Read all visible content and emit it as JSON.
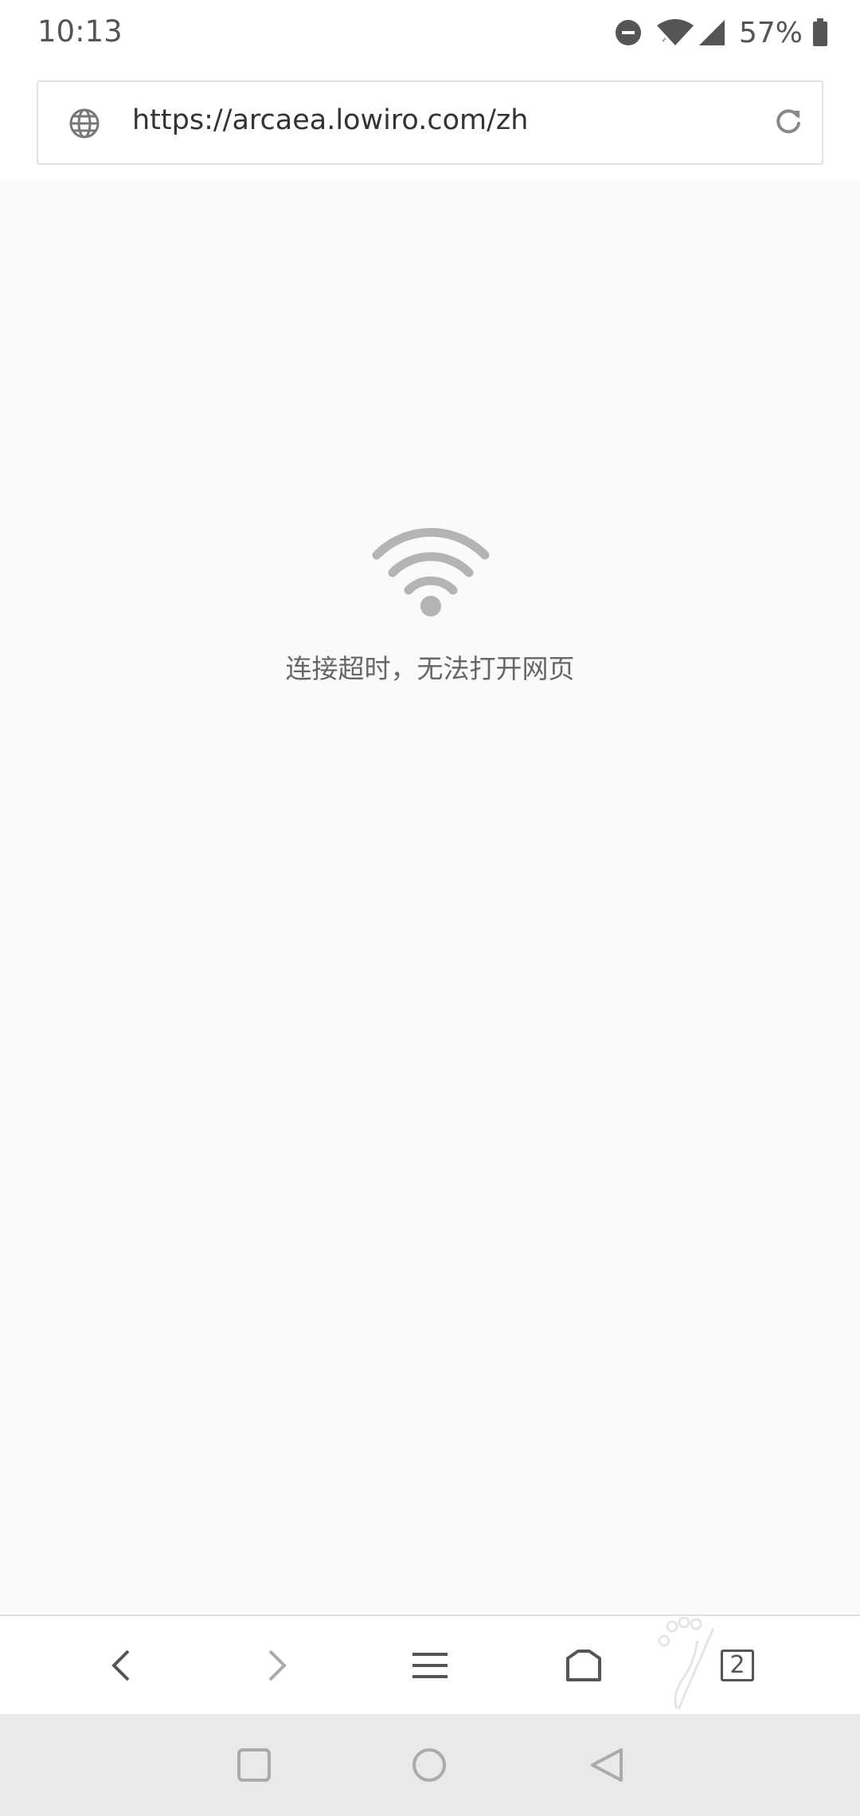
{
  "status_bar": {
    "time": "10:13",
    "battery_percent": "57%",
    "icons": [
      "do-not-disturb-icon",
      "wifi-icon",
      "cellular-signal-icon",
      "battery-icon"
    ]
  },
  "address_bar": {
    "url": "https://arcaea.lowiro.com/zh",
    "icons": [
      "globe-icon",
      "reload-icon"
    ]
  },
  "error_page": {
    "icon": "wifi-icon",
    "message": "连接超时，无法打开网页"
  },
  "browser_toolbar": {
    "buttons": [
      "back-icon",
      "forward-icon",
      "menu-icon",
      "home-icon",
      "tabs-icon"
    ],
    "tab_count": "2"
  },
  "system_nav": {
    "buttons": [
      "recents-icon",
      "home-circle-icon",
      "back-triangle-icon"
    ]
  },
  "colors": {
    "icon_gray": "#b4b4b4",
    "text_gray": "#666666",
    "background": "#fafafa",
    "nav_background": "#e9e9e9"
  }
}
